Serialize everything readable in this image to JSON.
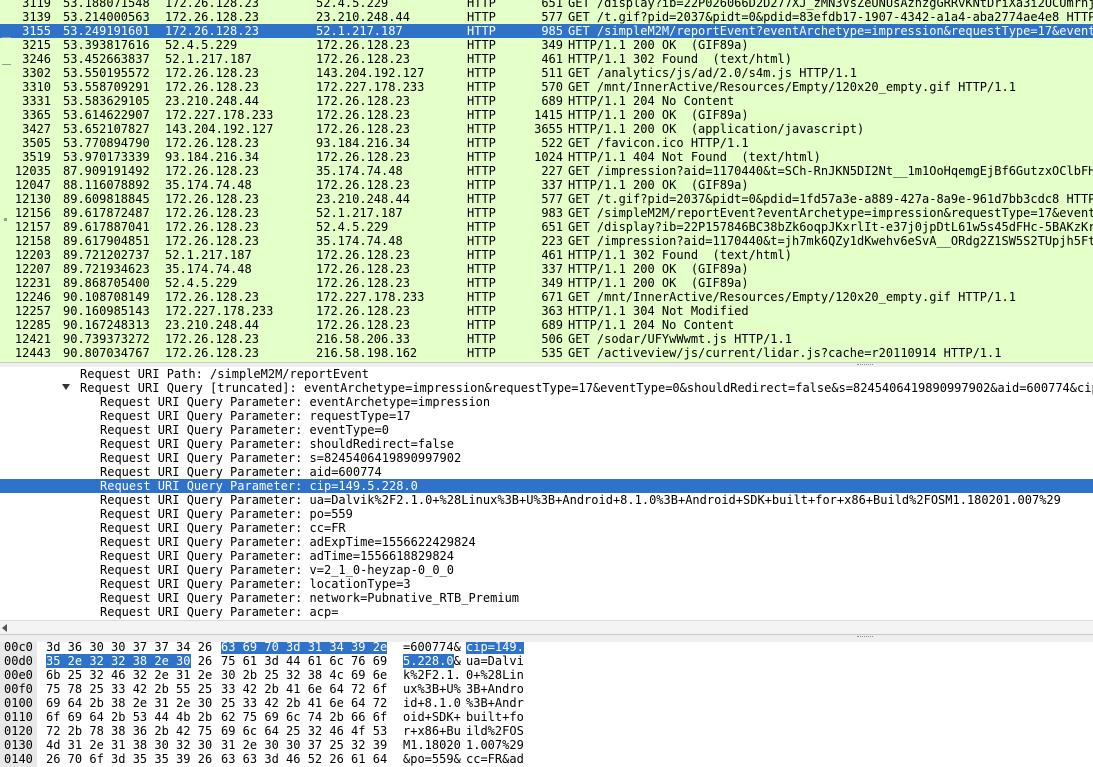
{
  "colors": {
    "row_bg": "#e4ffc7",
    "selection": "#2e73c9"
  },
  "packets": [
    {
      "no": "3119",
      "time": "53.188071548",
      "src": "172.26.128.23",
      "dst": "52.4.5.229",
      "proto": "HTTP",
      "len": "651",
      "info": "GET /display?ib=22P026066D2D277XJ_zMN3VsZeUNUsAznzgGRRvKNtDriXa3i2UCUmrnj",
      "selected": false
    },
    {
      "no": "3139",
      "time": "53.214000563",
      "src": "172.26.128.23",
      "dst": "23.210.248.44",
      "proto": "HTTP",
      "len": "577",
      "info": "GET /t.gif?pid=2037&pidt=0&pdid=83efdb17-1907-4342-a1a4-aba2774ae4e8 HTTP",
      "selected": false
    },
    {
      "no": "3155",
      "time": "53.249191601",
      "src": "172.26.128.23",
      "dst": "52.1.217.187",
      "proto": "HTTP",
      "len": "985",
      "info": "GET /simpleM2M/reportEvent?eventArchetype=impression&requestType=17&event",
      "selected": true
    },
    {
      "no": "3215",
      "time": "53.393817616",
      "src": "52.4.5.229",
      "dst": "172.26.128.23",
      "proto": "HTTP",
      "len": "349",
      "info": "HTTP/1.1 200 OK  (GIF89a)",
      "selected": false
    },
    {
      "no": "3246",
      "time": "53.452663837",
      "src": "52.1.217.187",
      "dst": "172.26.128.23",
      "proto": "HTTP",
      "len": "461",
      "info": "HTTP/1.1 302 Found  (text/html)",
      "selected": false
    },
    {
      "no": "3302",
      "time": "53.550195572",
      "src": "172.26.128.23",
      "dst": "143.204.192.127",
      "proto": "HTTP",
      "len": "511",
      "info": "GET /analytics/js/ad/2.0/s4m.js HTTP/1.1",
      "selected": false
    },
    {
      "no": "3310",
      "time": "53.558709291",
      "src": "172.26.128.23",
      "dst": "172.227.178.233",
      "proto": "HTTP",
      "len": "570",
      "info": "GET /mnt/InnerActive/Resources/Empty/120x20_empty.gif HTTP/1.1",
      "selected": false
    },
    {
      "no": "3331",
      "time": "53.583629105",
      "src": "23.210.248.44",
      "dst": "172.26.128.23",
      "proto": "HTTP",
      "len": "689",
      "info": "HTTP/1.1 204 No Content",
      "selected": false
    },
    {
      "no": "3365",
      "time": "53.614622907",
      "src": "172.227.178.233",
      "dst": "172.26.128.23",
      "proto": "HTTP",
      "len": "1415",
      "info": "HTTP/1.1 200 OK  (GIF89a)",
      "selected": false
    },
    {
      "no": "3427",
      "time": "53.652107827",
      "src": "143.204.192.127",
      "dst": "172.26.128.23",
      "proto": "HTTP",
      "len": "3655",
      "info": "HTTP/1.1 200 OK  (application/javascript)",
      "selected": false
    },
    {
      "no": "3505",
      "time": "53.770894790",
      "src": "172.26.128.23",
      "dst": "93.184.216.34",
      "proto": "HTTP",
      "len": "522",
      "info": "GET /favicon.ico HTTP/1.1",
      "selected": false
    },
    {
      "no": "3519",
      "time": "53.970173339",
      "src": "93.184.216.34",
      "dst": "172.26.128.23",
      "proto": "HTTP",
      "len": "1024",
      "info": "HTTP/1.1 404 Not Found  (text/html)",
      "selected": false
    },
    {
      "no": "12035",
      "time": "87.909191492",
      "src": "172.26.128.23",
      "dst": "35.174.74.48",
      "proto": "HTTP",
      "len": "227",
      "info": "GET /impression?aid=1170440&t=SCh-RnJKN5DI2Nt__1m1OoHqemgEjBf6GutzxOClbFH",
      "selected": false
    },
    {
      "no": "12047",
      "time": "88.116078892",
      "src": "35.174.74.48",
      "dst": "172.26.128.23",
      "proto": "HTTP",
      "len": "337",
      "info": "HTTP/1.1 200 OK  (GIF89a)",
      "selected": false
    },
    {
      "no": "12130",
      "time": "89.609818845",
      "src": "172.26.128.23",
      "dst": "23.210.248.44",
      "proto": "HTTP",
      "len": "577",
      "info": "GET /t.gif?pid=2037&pidt=0&pdid=1fd57a3e-a889-427a-8a9e-961d7bb3cdc8 HTTP",
      "selected": false
    },
    {
      "no": "12156",
      "time": "89.617872487",
      "src": "172.26.128.23",
      "dst": "52.1.217.187",
      "proto": "HTTP",
      "len": "983",
      "info": "GET /simpleM2M/reportEvent?eventArchetype=impression&requestType=17&event",
      "selected": false
    },
    {
      "no": "12157",
      "time": "89.617887041",
      "src": "172.26.128.23",
      "dst": "52.4.5.229",
      "proto": "HTTP",
      "len": "651",
      "info": "GET /display?ib=22P157846BC38bZk6oqpJKxrlIt-e37j0jpDtL61w5s45dFHc-5BAKzKr",
      "selected": false
    },
    {
      "no": "12158",
      "time": "89.617904851",
      "src": "172.26.128.23",
      "dst": "35.174.74.48",
      "proto": "HTTP",
      "len": "223",
      "info": "GET /impression?aid=1170440&t=jh7mk6QZy1dKwehv6eSvA__ORdg2Z1SW5S2TUpjh5Ft",
      "selected": false
    },
    {
      "no": "12203",
      "time": "89.721202737",
      "src": "52.1.217.187",
      "dst": "172.26.128.23",
      "proto": "HTTP",
      "len": "461",
      "info": "HTTP/1.1 302 Found  (text/html)",
      "selected": false
    },
    {
      "no": "12207",
      "time": "89.721934623",
      "src": "35.174.74.48",
      "dst": "172.26.128.23",
      "proto": "HTTP",
      "len": "337",
      "info": "HTTP/1.1 200 OK  (GIF89a)",
      "selected": false
    },
    {
      "no": "12231",
      "time": "89.868705400",
      "src": "52.4.5.229",
      "dst": "172.26.128.23",
      "proto": "HTTP",
      "len": "349",
      "info": "HTTP/1.1 200 OK  (GIF89a)",
      "selected": false
    },
    {
      "no": "12246",
      "time": "90.108708149",
      "src": "172.26.128.23",
      "dst": "172.227.178.233",
      "proto": "HTTP",
      "len": "671",
      "info": "GET /mnt/InnerActive/Resources/Empty/120x20_empty.gif HTTP/1.1",
      "selected": false
    },
    {
      "no": "12257",
      "time": "90.160985143",
      "src": "172.227.178.233",
      "dst": "172.26.128.23",
      "proto": "HTTP",
      "len": "363",
      "info": "HTTP/1.1 304 Not Modified",
      "selected": false
    },
    {
      "no": "12285",
      "time": "90.167248313",
      "src": "23.210.248.44",
      "dst": "172.26.128.23",
      "proto": "HTTP",
      "len": "689",
      "info": "HTTP/1.1 204 No Content",
      "selected": false
    },
    {
      "no": "12421",
      "time": "90.739373272",
      "src": "172.26.128.23",
      "dst": "216.58.206.33",
      "proto": "HTTP",
      "len": "506",
      "info": "GET /sodar/UFYwWwmt.js HTTP/1.1",
      "selected": false
    },
    {
      "no": "12443",
      "time": "90.807034767",
      "src": "172.26.128.23",
      "dst": "216.58.198.162",
      "proto": "HTTP",
      "len": "535",
      "info": "GET /activeview/js/current/lidar.js?cache=r20110914 HTTP/1.1",
      "selected": false
    }
  ],
  "details": [
    {
      "text": "Request URI Path: /simpleM2M/reportEvent",
      "indent": 80,
      "selected": false,
      "expander": false
    },
    {
      "text": "Request URI Query [truncated]: eventArchetype=impression&requestType=17&eventType=0&shouldRedirect=false&s=8245406419890997902&aid=600774&cip",
      "indent": 80,
      "selected": false,
      "expander": true
    },
    {
      "text": "Request URI Query Parameter: eventArchetype=impression",
      "indent": 100,
      "selected": false,
      "expander": false
    },
    {
      "text": "Request URI Query Parameter: requestType=17",
      "indent": 100,
      "selected": false,
      "expander": false
    },
    {
      "text": "Request URI Query Parameter: eventType=0",
      "indent": 100,
      "selected": false,
      "expander": false
    },
    {
      "text": "Request URI Query Parameter: shouldRedirect=false",
      "indent": 100,
      "selected": false,
      "expander": false
    },
    {
      "text": "Request URI Query Parameter: s=8245406419890997902",
      "indent": 100,
      "selected": false,
      "expander": false
    },
    {
      "text": "Request URI Query Parameter: aid=600774",
      "indent": 100,
      "selected": false,
      "expander": false
    },
    {
      "text": "Request URI Query Parameter: cip=149.5.228.0",
      "indent": 100,
      "selected": true,
      "expander": false
    },
    {
      "text": "Request URI Query Parameter: ua=Dalvik%2F2.1.0+%28Linux%3B+U%3B+Android+8.1.0%3B+Android+SDK+built+for+x86+Build%2FOSM1.180201.007%29",
      "indent": 100,
      "selected": false,
      "expander": false
    },
    {
      "text": "Request URI Query Parameter: po=559",
      "indent": 100,
      "selected": false,
      "expander": false
    },
    {
      "text": "Request URI Query Parameter: cc=FR",
      "indent": 100,
      "selected": false,
      "expander": false
    },
    {
      "text": "Request URI Query Parameter: adExpTime=1556622429824",
      "indent": 100,
      "selected": false,
      "expander": false
    },
    {
      "text": "Request URI Query Parameter: adTime=1556618829824",
      "indent": 100,
      "selected": false,
      "expander": false
    },
    {
      "text": "Request URI Query Parameter: v=2_1_0-heyzap-0_0_0",
      "indent": 100,
      "selected": false,
      "expander": false
    },
    {
      "text": "Request URI Query Parameter: locationType=3",
      "indent": 100,
      "selected": false,
      "expander": false
    },
    {
      "text": "Request URI Query Parameter: network=Pubnative_RTB_Premium",
      "indent": 100,
      "selected": false,
      "expander": false
    },
    {
      "text": "Request URI Query Parameter: acp=",
      "indent": 100,
      "selected": false,
      "expander": false
    },
    {
      "text": "Request URI Query Parameter: ...",
      "indent": 100,
      "selected": false,
      "expander": false
    }
  ],
  "hex": [
    {
      "offset": "00c0",
      "h1": "3d 36 30 30 37 37 34 26",
      "h2": "63 69 70 3d 31 34 39 2e",
      "a1": "=600774&",
      "a2": "cip=149.",
      "hl": "second"
    },
    {
      "offset": "00d0",
      "h1": "35 2e 32 32 38 2e 30",
      "h1b": " 26",
      "h2": "75 61 3d 44 61 6c 76 69",
      "a1": "5.228.0",
      "a1b": "&",
      "a2": "ua=Dalvi",
      "hl": "first"
    },
    {
      "offset": "00e0",
      "h1": "6b 25 32 46 32 2e 31 2e",
      "h2": "30 2b 25 32 38 4c 69 6e",
      "a1": "k%2F2.1.",
      "a2": "0+%28Lin",
      "hl": "none"
    },
    {
      "offset": "00f0",
      "h1": "75 78 25 33 42 2b 55 25",
      "h2": "33 42 2b 41 6e 64 72 6f",
      "a1": "ux%3B+U%",
      "a2": "3B+Andro",
      "hl": "none"
    },
    {
      "offset": "0100",
      "h1": "69 64 2b 38 2e 31 2e 30",
      "h2": "25 33 42 2b 41 6e 64 72",
      "a1": "id+8.1.0",
      "a2": "%3B+Andr",
      "hl": "none"
    },
    {
      "offset": "0110",
      "h1": "6f 69 64 2b 53 44 4b 2b",
      "h2": "62 75 69 6c 74 2b 66 6f",
      "a1": "oid+SDK+",
      "a2": "built+fo",
      "hl": "none"
    },
    {
      "offset": "0120",
      "h1": "72 2b 78 38 36 2b 42 75",
      "h2": "69 6c 64 25 32 46 4f 53",
      "a1": "r+x86+Bu",
      "a2": "ild%2FOS",
      "hl": "none"
    },
    {
      "offset": "0130",
      "h1": "4d 31 2e 31 38 30 32 30",
      "h2": "31 2e 30 30 37 25 32 39",
      "a1": "M1.18020",
      "a2": "1.007%29",
      "hl": "none"
    },
    {
      "offset": "0140",
      "h1": "26 70 6f 3d 35 35 39 26",
      "h2": "63 63 3d 46 52 26 61 64",
      "a1": "&po=559&",
      "a2": "cc=FR&ad",
      "hl": "none"
    }
  ]
}
